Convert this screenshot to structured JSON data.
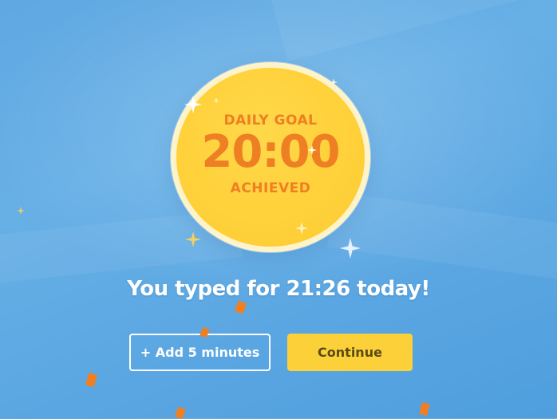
{
  "goal": {
    "label_top": "DAILY GOAL",
    "time": "20:00",
    "label_bottom": "ACHIEVED"
  },
  "result_text": "You typed for 21:26 today!",
  "buttons": {
    "add_label": "+ Add 5 minutes",
    "continue_label": "Continue"
  },
  "colors": {
    "background": "#5fa8e2",
    "medal": "#ffd13a",
    "medal_text": "#ee7f22",
    "continue_button": "#fcd039",
    "confetti": "#f07f22"
  },
  "icons": {
    "sparkle": "four-point-star-icon"
  }
}
